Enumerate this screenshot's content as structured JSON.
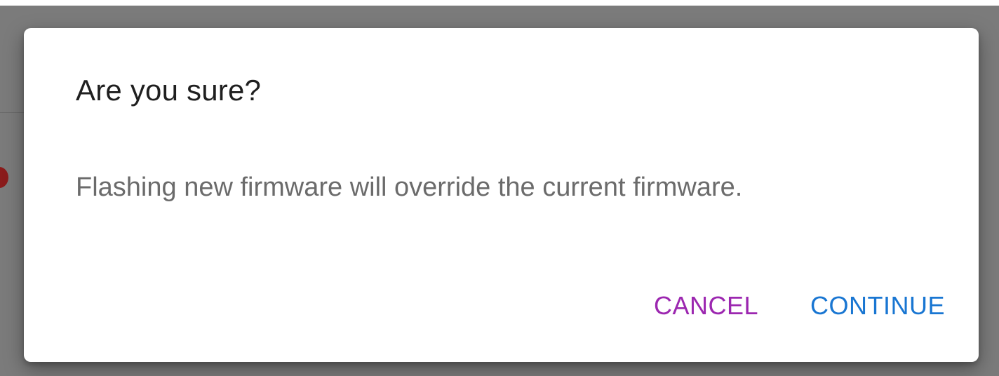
{
  "dialog": {
    "title": "Are you sure?",
    "message": "Flashing new firmware will override the current firmware.",
    "actions": {
      "cancel_label": "CANCEL",
      "continue_label": "CONTINUE"
    }
  },
  "colors": {
    "cancel": "#9C27B0",
    "continue": "#1976D2",
    "scrim": "#7b7b7b"
  }
}
